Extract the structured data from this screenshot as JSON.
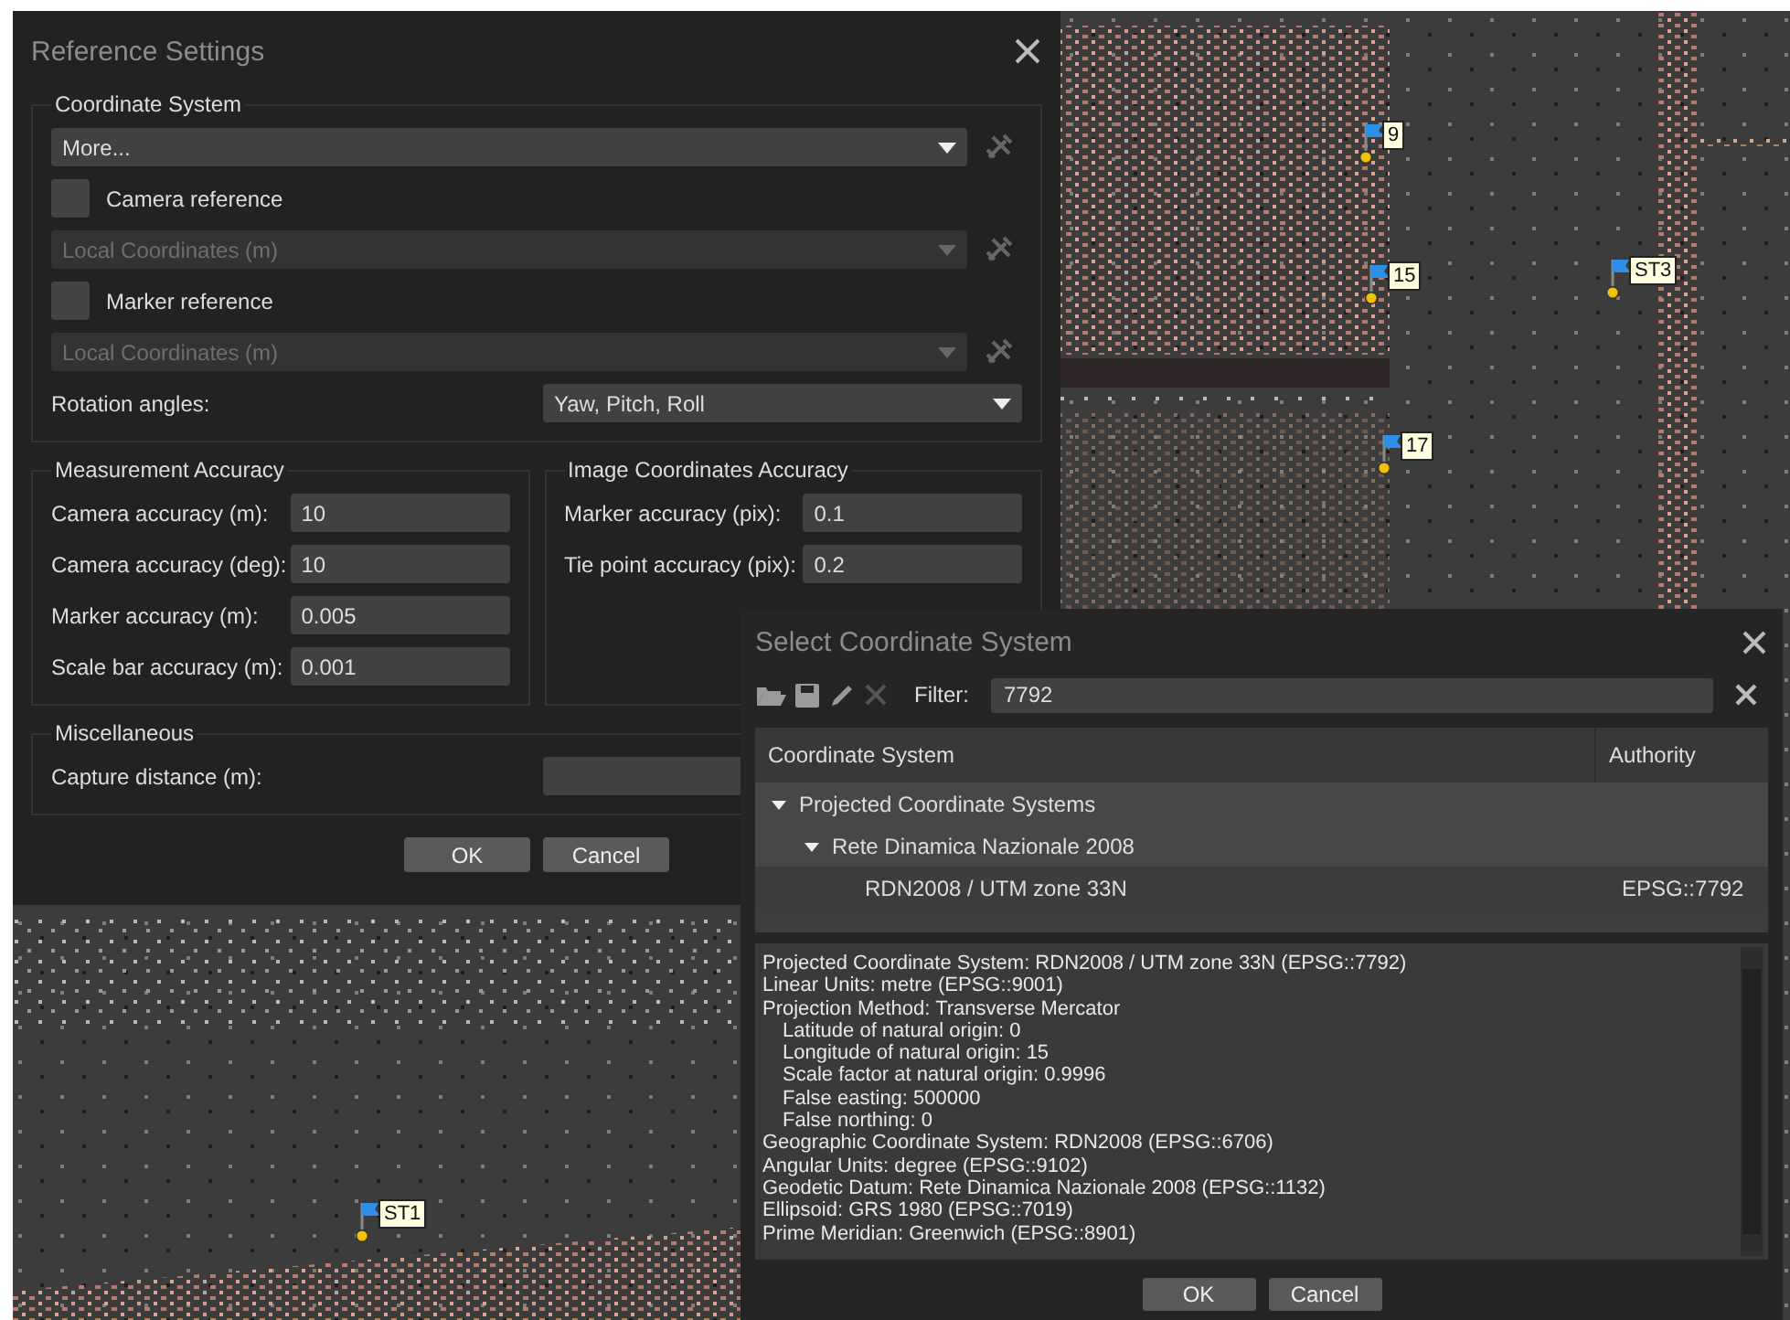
{
  "viewport": {
    "markers": [
      {
        "label": "9"
      },
      {
        "label": "15"
      },
      {
        "label": "ST3"
      },
      {
        "label": "17"
      },
      {
        "label": "ST1"
      }
    ]
  },
  "reference_dialog": {
    "title": "Reference Settings",
    "coordinate_system": {
      "title": "Coordinate System",
      "rows": [
        {
          "kind": "combo",
          "value": "More...",
          "disabled": false
        },
        {
          "kind": "checkbox",
          "label": "Camera reference",
          "checked": false
        },
        {
          "kind": "combo",
          "value": "Local Coordinates (m)",
          "disabled": true
        },
        {
          "kind": "checkbox",
          "label": "Marker reference",
          "checked": false
        },
        {
          "kind": "combo",
          "value": "Local Coordinates (m)",
          "disabled": true
        },
        {
          "kind": "labeled_combo",
          "label": "Rotation angles:",
          "value": "Yaw, Pitch, Roll"
        }
      ]
    },
    "measurement_accuracy": {
      "title": "Measurement Accuracy",
      "fields": [
        {
          "label": "Camera accuracy (m):",
          "value": "10"
        },
        {
          "label": "Camera accuracy (deg):",
          "value": "10"
        },
        {
          "label": "Marker accuracy (m):",
          "value": "0.005"
        },
        {
          "label": "Scale bar accuracy (m):",
          "value": "0.001"
        }
      ]
    },
    "image_coordinates_accuracy": {
      "title": "Image Coordinates Accuracy",
      "fields": [
        {
          "label": "Marker accuracy (pix):",
          "value": "0.1"
        },
        {
          "label": "Tie point accuracy (pix):",
          "value": "0.2"
        }
      ]
    },
    "miscellaneous": {
      "title": "Miscellaneous",
      "fields": [
        {
          "label": "Capture distance (m):"
        }
      ]
    },
    "buttons": [
      "OK",
      "Cancel"
    ]
  },
  "select_dialog": {
    "title": "Select Coordinate System",
    "tools": [
      {
        "kind": "open",
        "disabled": false
      },
      {
        "kind": "save",
        "disabled": false
      },
      {
        "kind": "edit",
        "disabled": false
      },
      {
        "kind": "delete",
        "disabled": true
      }
    ],
    "filter": {
      "label": "Filter:",
      "value": "7792"
    },
    "tree": {
      "columns": [
        "Coordinate System",
        "Authority"
      ],
      "rows": [
        {
          "name": "Projected Coordinate Systems",
          "expanded": true,
          "children": [
            {
              "name": "Rete Dinamica Nazionale 2008",
              "expanded": true,
              "children": [
                {
                  "name": "RDN2008 / UTM zone 33N",
                  "authority": "EPSG::7792"
                }
              ]
            }
          ]
        }
      ]
    },
    "details": [
      {
        "text": "Projected Coordinate System: RDN2008 / UTM zone 33N (EPSG::7792)"
      },
      {
        "text": "Linear Units: metre (EPSG::9001)"
      },
      {
        "text": "Projection Method: Transverse Mercator",
        "children": [
          {
            "text": "Latitude of natural origin: 0"
          },
          {
            "text": "Longitude of natural origin: 15"
          },
          {
            "text": "Scale factor at natural origin: 0.9996"
          },
          {
            "text": "False easting: 500000"
          },
          {
            "text": "False northing: 0"
          }
        ]
      },
      {
        "text": "Geographic Coordinate System: RDN2008 (EPSG::6706)"
      },
      {
        "text": "Angular Units: degree (EPSG::9102)"
      },
      {
        "text": "Geodetic Datum: Rete Dinamica Nazionale 2008 (EPSG::1132)"
      },
      {
        "text": "Ellipsoid: GRS 1980 (EPSG::7019)"
      },
      {
        "text": "Prime Meridian: Greenwich (EPSG::8901)"
      }
    ],
    "buttons": [
      "OK",
      "Cancel"
    ]
  }
}
